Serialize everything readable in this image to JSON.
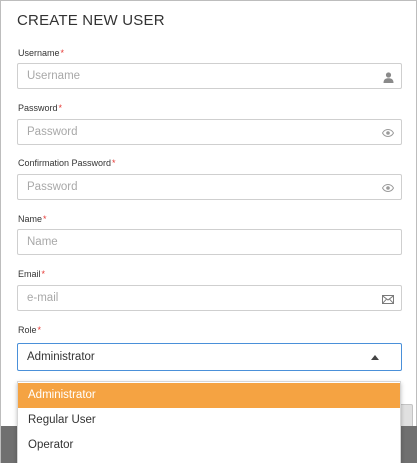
{
  "dialog": {
    "title": "CREATE NEW USER",
    "required_marker": "*"
  },
  "fields": {
    "username": {
      "label": "Username",
      "placeholder": "Username",
      "value": "",
      "icon": "user-icon"
    },
    "password": {
      "label": "Password",
      "placeholder": "Password",
      "value": "",
      "icon": "eye-icon"
    },
    "confirm_password": {
      "label": "Confirmation Password",
      "placeholder": "Password",
      "value": "",
      "icon": "eye-icon"
    },
    "name": {
      "label": "Name",
      "placeholder": "Name",
      "value": ""
    },
    "email": {
      "label": "Email",
      "placeholder": "e-mail",
      "value": "",
      "icon": "envelope-icon"
    }
  },
  "role": {
    "label": "Role",
    "selected": "Administrator",
    "options": [
      "Administrator",
      "Regular User",
      "Operator"
    ],
    "highlighted_index": 0
  },
  "colors": {
    "required": "#e53935",
    "highlight": "#f5a342",
    "focus_border": "#4a90d9"
  }
}
